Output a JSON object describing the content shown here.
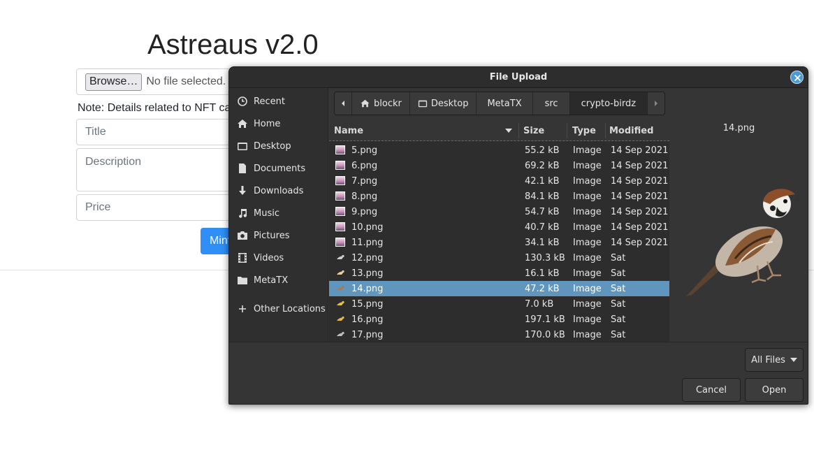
{
  "page": {
    "title": "Astreaus v2.0",
    "browse_label": "Browse…",
    "file_status": "No file selected.",
    "note": "Note: Details related to NFT ca",
    "title_placeholder": "Title",
    "description_placeholder": "Description",
    "price_placeholder": "Price",
    "mint_label": "Mint"
  },
  "dialog": {
    "title": "File Upload",
    "sidebar": [
      {
        "label": "Recent",
        "icon": "clock-icon"
      },
      {
        "label": "Home",
        "icon": "home-icon"
      },
      {
        "label": "Desktop",
        "icon": "desktop-folder-icon"
      },
      {
        "label": "Documents",
        "icon": "document-icon"
      },
      {
        "label": "Downloads",
        "icon": "download-icon"
      },
      {
        "label": "Music",
        "icon": "music-icon"
      },
      {
        "label": "Pictures",
        "icon": "camera-icon"
      },
      {
        "label": "Videos",
        "icon": "film-icon"
      },
      {
        "label": "MetaTX",
        "icon": "folder-icon"
      },
      {
        "label": "Other Locations",
        "icon": "plus-icon"
      }
    ],
    "path": [
      "blockr",
      "Desktop",
      "MetaTX",
      "src",
      "crypto-birdz"
    ],
    "columns": {
      "name": "Name",
      "size": "Size",
      "type": "Type",
      "modified": "Modified"
    },
    "files": [
      {
        "name": "5.png",
        "size": "55.2 kB",
        "type": "Image",
        "modified": "14 Sep 2021"
      },
      {
        "name": "6.png",
        "size": "69.2 kB",
        "type": "Image",
        "modified": "14 Sep 2021"
      },
      {
        "name": "7.png",
        "size": "42.1 kB",
        "type": "Image",
        "modified": "14 Sep 2021"
      },
      {
        "name": "8.png",
        "size": "84.1 kB",
        "type": "Image",
        "modified": "14 Sep 2021"
      },
      {
        "name": "9.png",
        "size": "54.7 kB",
        "type": "Image",
        "modified": "14 Sep 2021"
      },
      {
        "name": "10.png",
        "size": "40.7 kB",
        "type": "Image",
        "modified": "14 Sep 2021"
      },
      {
        "name": "11.png",
        "size": "34.1 kB",
        "type": "Image",
        "modified": "14 Sep 2021"
      },
      {
        "name": "12.png",
        "size": "130.3 kB",
        "type": "Image",
        "modified": "Sat"
      },
      {
        "name": "13.png",
        "size": "16.1 kB",
        "type": "Image",
        "modified": "Sat"
      },
      {
        "name": "14.png",
        "size": "47.2 kB",
        "type": "Image",
        "modified": "Sat"
      },
      {
        "name": "15.png",
        "size": "7.0 kB",
        "type": "Image",
        "modified": "Sat"
      },
      {
        "name": "16.png",
        "size": "197.1 kB",
        "type": "Image",
        "modified": "Sat"
      },
      {
        "name": "17.png",
        "size": "170.0 kB",
        "type": "Image",
        "modified": "Sat"
      }
    ],
    "preview_name": "14.png",
    "filter_label": "All Files",
    "cancel_label": "Cancel",
    "open_label": "Open",
    "accent_color": "#6096bd"
  }
}
